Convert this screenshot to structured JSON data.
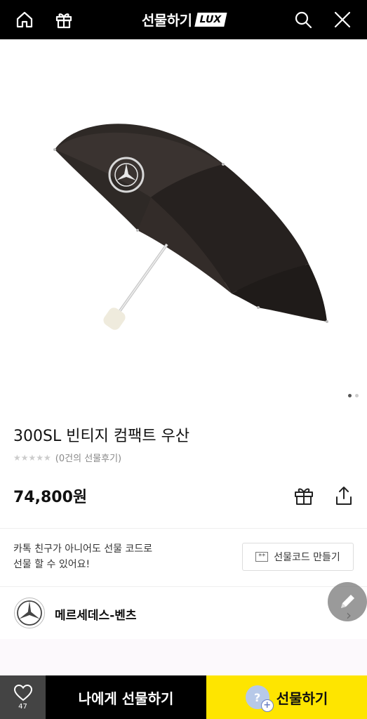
{
  "header": {
    "brand_name": "선물하기",
    "brand_badge": "LUX"
  },
  "icons": {
    "home": "home-icon",
    "gift": "gift-icon",
    "search": "search-icon",
    "close": "close-icon"
  },
  "gallery": {
    "slides": 2,
    "active": 1
  },
  "product": {
    "title": "300SL 빈티지 컴팩트 우산",
    "rating_stars": 0,
    "review_text": "(0건의 선물후기)",
    "price": "74,800원"
  },
  "gift_code": {
    "line1": "카톡 친구가 아니어도 선물 코드로",
    "line2": "선물 할 수 있어요!",
    "button_tag": "**",
    "button_label": "선물코드 만들기"
  },
  "brand": {
    "name": "메르세데스-벤츠"
  },
  "bottom_bar": {
    "like_count": "47",
    "self_gift_label": "나에게 선물하기",
    "gift_label": "선물하기",
    "avatar_glyph": "?",
    "avatar_plus": "+"
  },
  "colors": {
    "header_bg": "#000000",
    "accent_yellow": "#fee500",
    "like_bg": "#444444"
  }
}
